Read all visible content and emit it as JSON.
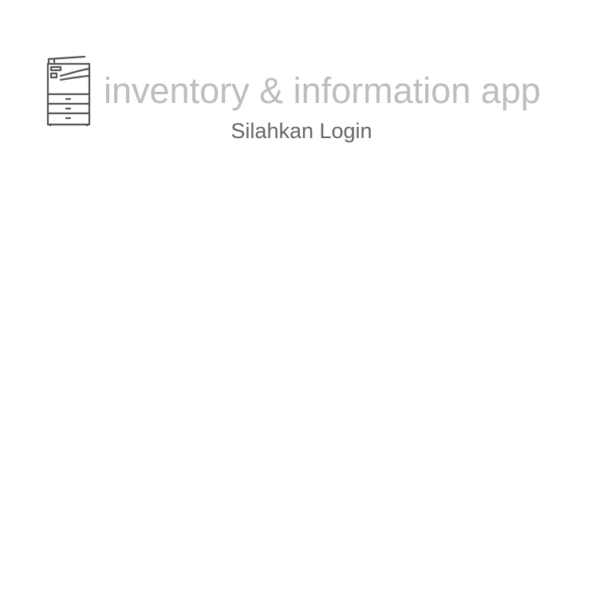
{
  "header": {
    "logo_icon": "copier-machine-icon",
    "app_title": "inventory & information app",
    "subtitle": "Silahkan Login"
  },
  "colors": {
    "title": "#bdbdbd",
    "subtitle": "#666666",
    "icon": "#555555",
    "background": "#ffffff"
  }
}
